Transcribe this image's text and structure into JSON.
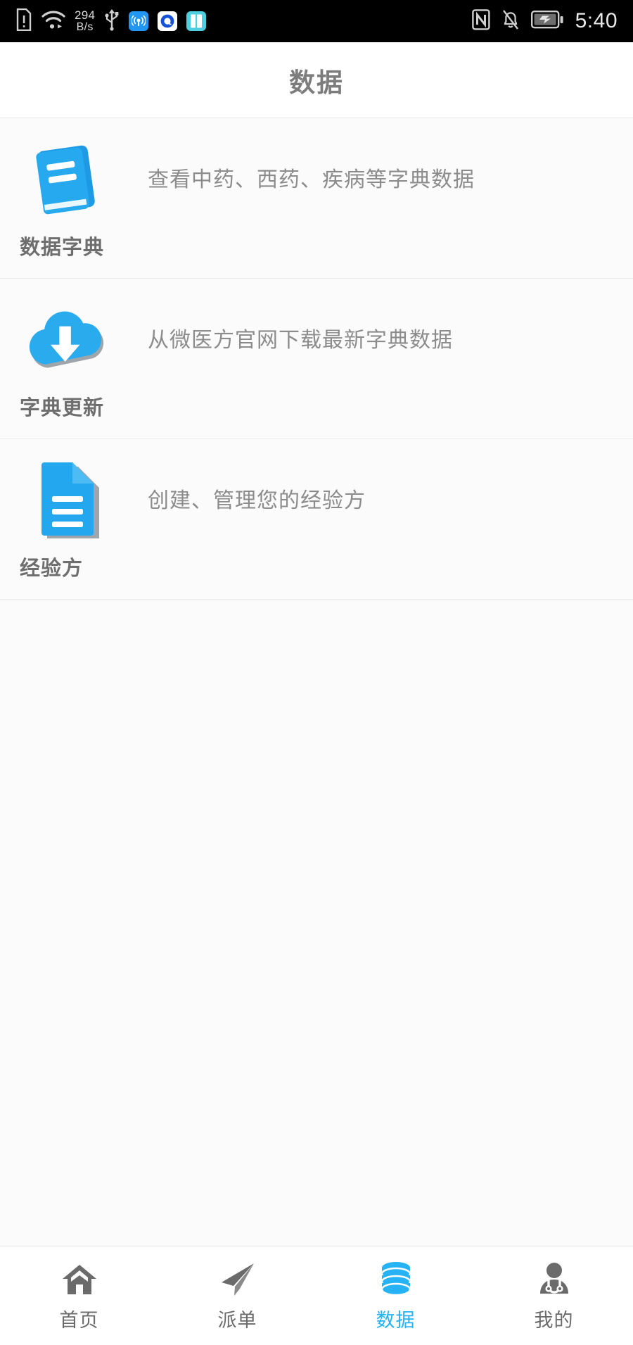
{
  "status_bar": {
    "network_speed_value": "294",
    "network_speed_unit": "B/s",
    "time": "5:40",
    "left_icons": [
      "sim-alert-icon",
      "wifi-icon",
      "network-speed-indicator",
      "usb-icon",
      "hotspot-app-icon",
      "blue-circle-app-icon",
      "book-app-icon"
    ],
    "right_icons": [
      "nfc-icon",
      "silent-bell-icon",
      "battery-charging-icon"
    ]
  },
  "header": {
    "title": "数据"
  },
  "list": {
    "items": [
      {
        "icon": "blue-book-icon",
        "description": "查看中药、西药、疾病等字典数据",
        "label": "数据字典"
      },
      {
        "icon": "cloud-download-icon",
        "description": "从微医方官网下载最新字典数据",
        "label": "字典更新"
      },
      {
        "icon": "document-lines-icon",
        "description": "创建、管理您的经验方",
        "label": "经验方"
      }
    ]
  },
  "tabbar": {
    "active_index": 2,
    "items": [
      {
        "icon": "home-icon",
        "label": "首页"
      },
      {
        "icon": "paper-plane-icon",
        "label": "派单"
      },
      {
        "icon": "database-icon",
        "label": "数据"
      },
      {
        "icon": "doctor-icon",
        "label": "我的"
      }
    ]
  },
  "colors": {
    "accent": "#25b3f5",
    "icon_blue": "#2aabee",
    "text_gray": "#8c8c8c",
    "label_gray": "#6e6e6e",
    "status_bar_bg": "#000000",
    "page_bg": "#fbfbfb"
  }
}
